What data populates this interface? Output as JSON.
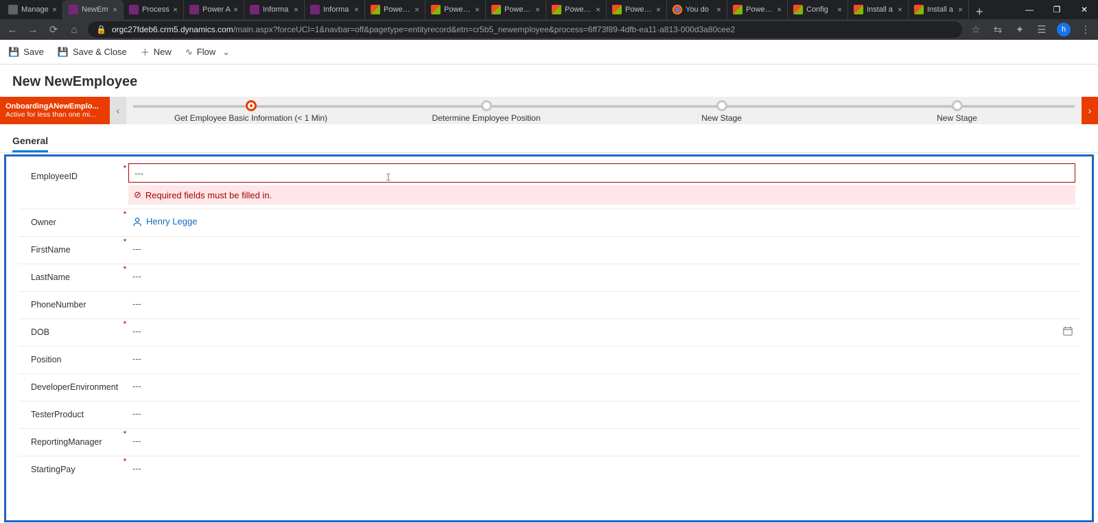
{
  "browser": {
    "tabs": [
      {
        "title": "Manage",
        "icon": "generic"
      },
      {
        "title": "NewEm",
        "icon": "purple",
        "active": true
      },
      {
        "title": "Process",
        "icon": "purple"
      },
      {
        "title": "Power A",
        "icon": "purple"
      },
      {
        "title": "Informa",
        "icon": "purple"
      },
      {
        "title": "Informa",
        "icon": "purple"
      },
      {
        "title": "Power P",
        "icon": "ms"
      },
      {
        "title": "Power P",
        "icon": "ms"
      },
      {
        "title": "Power P",
        "icon": "ms"
      },
      {
        "title": "Power P",
        "icon": "ms"
      },
      {
        "title": "Power P",
        "icon": "ms"
      },
      {
        "title": "You do",
        "icon": "google"
      },
      {
        "title": "Power P",
        "icon": "ms"
      },
      {
        "title": "Config",
        "icon": "ms"
      },
      {
        "title": "Install a",
        "icon": "ms"
      },
      {
        "title": "Install a",
        "icon": "ms"
      }
    ],
    "url_host": "orgc27fdeb6.crm5.dynamics.com",
    "url_path": "/main.aspx?forceUCI=1&navbar=off&pagetype=entityrecord&etn=cr5b5_newemployee&process=6ff73f89-4dfb-ea11-a813-000d3a80cee2",
    "profile_initial": "h"
  },
  "commands": {
    "save": "Save",
    "save_close": "Save & Close",
    "new": "New",
    "flow": "Flow"
  },
  "header": {
    "title": "New NewEmployee"
  },
  "bpf": {
    "process_name": "OnboardingANewEmplo...",
    "status": "Active for less than one mi...",
    "stages": [
      {
        "label": "Get Employee Basic Information  (< 1 Min)",
        "active": true
      },
      {
        "label": "Determine Employee Position"
      },
      {
        "label": "New Stage"
      },
      {
        "label": "New Stage"
      }
    ]
  },
  "form": {
    "tab_label": "General",
    "error_msg": "Required fields must be filled in.",
    "empty": "---",
    "owner_value": "Henry Legge",
    "fields": {
      "employeeid": "EmployeeID",
      "owner": "Owner",
      "firstname": "FirstName",
      "lastname": "LastName",
      "phone": "PhoneNumber",
      "dob": "DOB",
      "position": "Position",
      "devenv": "DeveloperEnvironment",
      "tester": "TesterProduct",
      "manager": "ReportingManager",
      "pay": "StartingPay"
    }
  }
}
